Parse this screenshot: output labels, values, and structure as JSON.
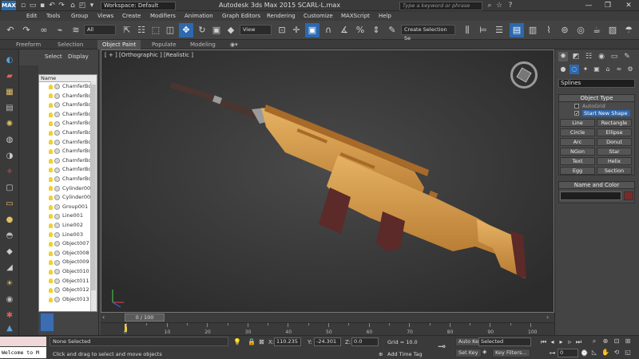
{
  "titlebar": {
    "logo": "MAX",
    "workspace_value": "Workspace: Default",
    "app_title": "Autodesk 3ds Max  2015    SCARL-L.max",
    "search_placeholder": "Type a keyword or phrase",
    "window_controls": [
      "—",
      "❐",
      "✕"
    ]
  },
  "menubar": {
    "items": [
      "Edit",
      "Tools",
      "Group",
      "Views",
      "Create",
      "Modifiers",
      "Animation",
      "Graph Editors",
      "Rendering",
      "Customize",
      "MAXScript",
      "Help"
    ]
  },
  "toolbar": {
    "selection_filter": "All",
    "reference_coord": "View",
    "named_selection_placeholder": "Create Selection Se"
  },
  "ribbon": {
    "tabs": [
      "Freeform",
      "Selection",
      "Object Paint",
      "Populate",
      "Modeling"
    ],
    "active_tab": "Object Paint"
  },
  "scene_explorer": {
    "menu": [
      "Select",
      "Display"
    ],
    "column_header": "Name",
    "rows": [
      {
        "label": "ChamferBo"
      },
      {
        "label": "ChamferBo"
      },
      {
        "label": "ChamferBo"
      },
      {
        "label": "ChamferBo"
      },
      {
        "label": "ChamferBo"
      },
      {
        "label": "ChamferBo"
      },
      {
        "label": "ChamferBo"
      },
      {
        "label": "ChamferBo"
      },
      {
        "label": "ChamferBo"
      },
      {
        "label": "ChamferBo"
      },
      {
        "label": "ChamferBo"
      },
      {
        "label": "Cylinder00"
      },
      {
        "label": "Cylinder00"
      },
      {
        "label": "Group001"
      },
      {
        "label": "Line001"
      },
      {
        "label": "Line002"
      },
      {
        "label": "Line003"
      },
      {
        "label": "Object007"
      },
      {
        "label": "Object008"
      },
      {
        "label": "Object009"
      },
      {
        "label": "Object010"
      },
      {
        "label": "Object011"
      },
      {
        "label": "Object012"
      },
      {
        "label": "Object013"
      }
    ]
  },
  "viewport": {
    "label": "[ + ] [Orthographic ] [Realistic ]",
    "model_colors": {
      "body": "#d9a050",
      "shadow": "#a86a28",
      "grip": "#5c2a28",
      "barrel": "#4a3530",
      "metal": "#9a9a9a"
    }
  },
  "command_panel": {
    "category_value": "Splines",
    "object_type_title": "Object Type",
    "autogrid_label": "AutoGrid",
    "start_new_shape_label": "Start New Shape",
    "shape_buttons": [
      "Line",
      "Rectangle",
      "Circle",
      "Ellipse",
      "Arc",
      "Donut",
      "NGon",
      "Star",
      "Text",
      "Helix",
      "Egg",
      "Section"
    ],
    "name_color_title": "Name and Color",
    "color_swatch": "#7a2a2a"
  },
  "timeline": {
    "frame_label": "0 / 100",
    "ticks": [
      "0",
      "10",
      "20",
      "30",
      "40",
      "50",
      "60",
      "70",
      "80",
      "90",
      "100"
    ]
  },
  "statusbar": {
    "maxscript_text": "Welcome to M",
    "selection_status": "None Selected",
    "prompt": "Click and drag to select and move objects",
    "x_value": "110.235",
    "y_value": "-24.301",
    "z_value": "0.0",
    "grid_text": "Grid = 10.0",
    "add_time_tag": "Add Time Tag",
    "auto_key": "Auto Key",
    "auto_key_mode": "Selected",
    "set_key": "Set Key",
    "key_filters": "Key Filters...",
    "frame_value": "0"
  }
}
